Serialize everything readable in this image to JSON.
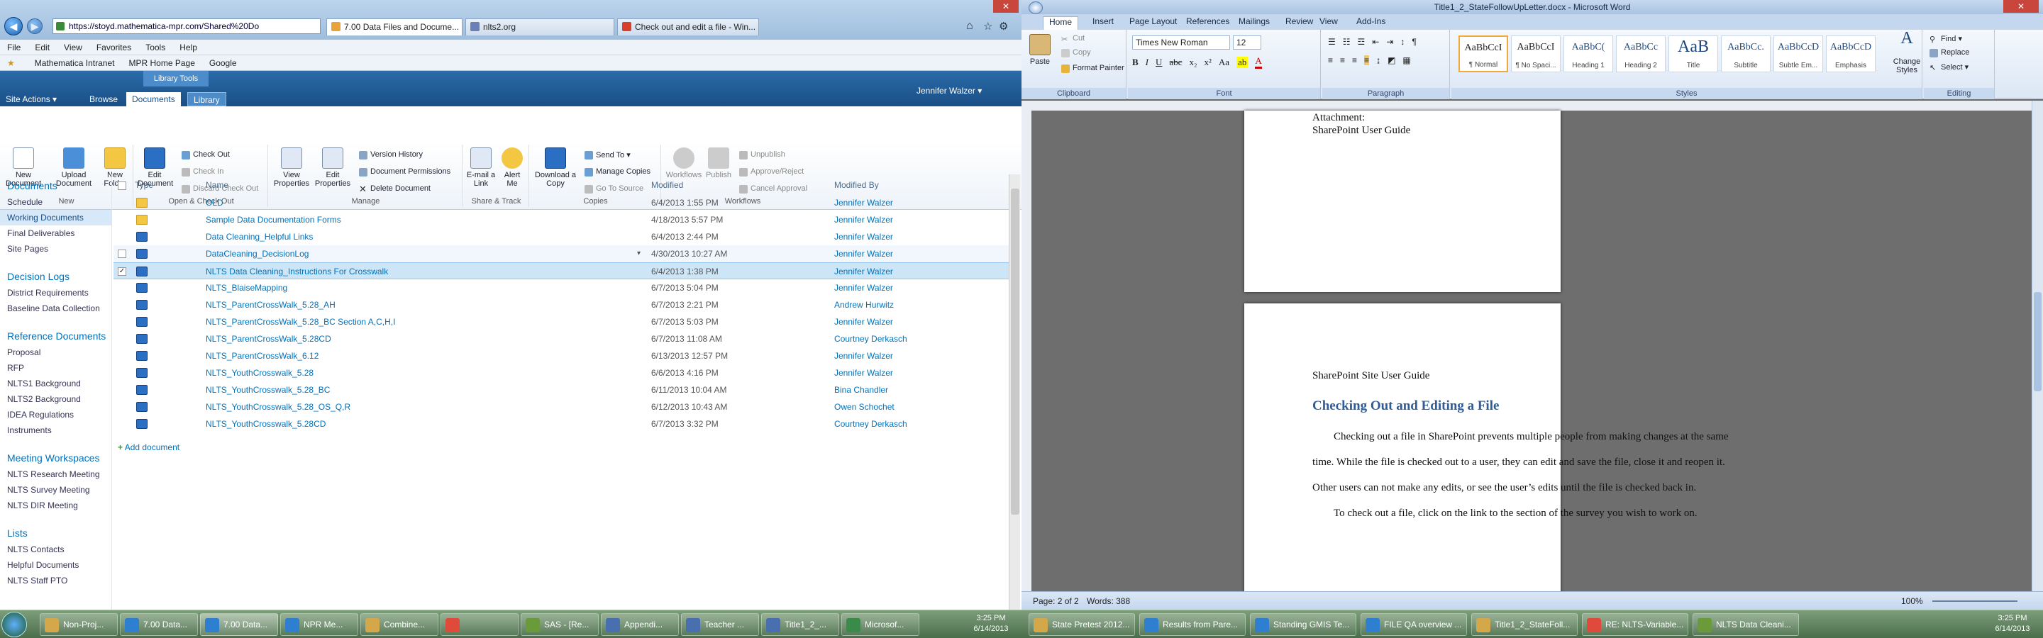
{
  "ie": {
    "url": "https://stoyd.mathematica-mpr.com/Shared%20Do",
    "tabs": [
      "7.00 Data Files and Docume...",
      "nlts2.org",
      "Check out and edit a file - Win..."
    ],
    "menu": [
      "File",
      "Edit",
      "View",
      "Favorites",
      "Tools",
      "Help"
    ],
    "favorites": [
      "Mathematica Intranet",
      "MPR Home Page",
      "Google"
    ]
  },
  "sp": {
    "site_actions": "Site Actions",
    "tabs": [
      "Browse",
      "Documents",
      "Library"
    ],
    "library_tools": "Library Tools",
    "user": "Jennifer Walzer",
    "ribbon_groups": [
      {
        "label": "New",
        "big": [
          "New Document",
          "Upload Document",
          "New Folder"
        ]
      },
      {
        "label": "Open & Check Out",
        "big": [
          "Edit Document"
        ],
        "small": [
          "Check Out",
          "Check In",
          "Discard Check Out"
        ]
      },
      {
        "label": "Manage",
        "big": [
          "View Properties",
          "Edit Properties"
        ],
        "small": [
          "Version History",
          "Document Permissions",
          "Delete Document"
        ]
      },
      {
        "label": "Share & Track",
        "big": [
          "E-mail a Link",
          "Alert Me"
        ]
      },
      {
        "label": "Copies",
        "big": [
          "Download a Copy"
        ],
        "small": [
          "Send To",
          "Manage Copies",
          "Go To Source"
        ]
      },
      {
        "label": "Workflows",
        "big": [
          "Workflows",
          "Publish"
        ],
        "small": [
          "Unpublish",
          "Approve/Reject",
          "Cancel Approval"
        ]
      }
    ],
    "nav": {
      "documents": {
        "head": "Documents",
        "items": [
          "Schedule",
          "Working Documents",
          "Final Deliverables",
          "Site Pages"
        ]
      },
      "decision": {
        "head": "Decision Logs",
        "items": [
          "District Requirements",
          "Baseline Data Collection"
        ]
      },
      "reference": {
        "head": "Reference Documents",
        "items": [
          "Proposal",
          "RFP",
          "NLTS1 Background",
          "NLTS2 Background",
          "IDEA Regulations",
          "Instruments"
        ]
      },
      "meeting": {
        "head": "Meeting Workspaces",
        "items": [
          "NLTS Research Meeting",
          "NLTS Survey Meeting",
          "NLTS DIR Meeting"
        ]
      },
      "lists": {
        "head": "Lists",
        "items": [
          "NLTS Contacts",
          "Helpful Documents",
          "NLTS Staff PTO"
        ]
      }
    },
    "columns": {
      "type": "Type",
      "name": "Name",
      "modified": "Modified",
      "by": "Modified By"
    },
    "rows": [
      {
        "kind": "folder",
        "name": "OLD",
        "modified": "6/4/2013 1:55 PM",
        "by": "Jennifer Walzer"
      },
      {
        "kind": "folder",
        "name": "Sample Data Documentation Forms",
        "modified": "4/18/2013 5:57 PM",
        "by": "Jennifer Walzer"
      },
      {
        "kind": "doc",
        "name": "Data Cleaning_Helpful Links",
        "modified": "6/4/2013 2:44 PM",
        "by": "Jennifer Walzer"
      },
      {
        "kind": "doc",
        "name": "DataCleaning_DecisionLog",
        "modified": "4/30/2013 10:27 AM",
        "by": "Jennifer Walzer"
      },
      {
        "kind": "doc",
        "name": "NLTS Data Cleaning_Instructions For Crosswalk",
        "modified": "6/4/2013 1:38 PM",
        "by": "Jennifer Walzer"
      },
      {
        "kind": "doc",
        "name": "NLTS_BlaiseMapping",
        "modified": "6/7/2013 5:04 PM",
        "by": "Jennifer Walzer"
      },
      {
        "kind": "doc",
        "name": "NLTS_ParentCrossWalk_5.28_AH",
        "modified": "6/7/2013 2:21 PM",
        "by": "Andrew Hurwitz"
      },
      {
        "kind": "doc",
        "name": "NLTS_ParentCrossWalk_5.28_BC Section A,C,H,I",
        "modified": "6/7/2013 5:03 PM",
        "by": "Jennifer Walzer"
      },
      {
        "kind": "doc",
        "name": "NLTS_ParentCrossWalk_5.28CD",
        "modified": "6/7/2013 11:08 AM",
        "by": "Courtney Derkasch"
      },
      {
        "kind": "doc",
        "name": "NLTS_ParentCrossWalk_6.12",
        "modified": "6/13/2013 12:57 PM",
        "by": "Jennifer Walzer"
      },
      {
        "kind": "doc",
        "name": "NLTS_YouthCrosswalk_5.28",
        "modified": "6/6/2013 4:16 PM",
        "by": "Jennifer Walzer"
      },
      {
        "kind": "doc",
        "name": "NLTS_YouthCrosswalk_5.28_BC",
        "modified": "6/11/2013 10:04 AM",
        "by": "Bina Chandler"
      },
      {
        "kind": "doc",
        "name": "NLTS_YouthCrosswalk_5.28_OS_Q,R",
        "modified": "6/12/2013 10:43 AM",
        "by": "Owen Schochet"
      },
      {
        "kind": "doc",
        "name": "NLTS_YouthCrosswalk_5.28CD",
        "modified": "6/7/2013 3:32 PM",
        "by": "Courtney Derkasch"
      }
    ],
    "add_document": "Add document"
  },
  "word": {
    "title": "Title1_2_StateFollowUpLetter.docx - Microsoft Word",
    "tabs": [
      "Home",
      "Insert",
      "Page Layout",
      "References",
      "Mailings",
      "Review",
      "View",
      "Add-Ins"
    ],
    "clipboard": {
      "paste": "Paste",
      "cut": "Cut",
      "copy": "Copy",
      "painter": "Format Painter",
      "label": "Clipboard"
    },
    "font": {
      "name": "Times New Roman",
      "size": "12",
      "label": "Font"
    },
    "paragraph_label": "Paragraph",
    "styles_label": "Styles",
    "styles": [
      {
        "sample": "AaBbCcI",
        "name": "¶ Normal"
      },
      {
        "sample": "AaBbCcI",
        "name": "¶ No Spaci..."
      },
      {
        "sample": "AaBbC(",
        "name": "Heading 1"
      },
      {
        "sample": "AaBbCc",
        "name": "Heading 2"
      },
      {
        "sample": "AaB",
        "name": "Title"
      },
      {
        "sample": "AaBbCc.",
        "name": "Subtitle"
      },
      {
        "sample": "AaBbCcD",
        "name": "Subtle Em..."
      },
      {
        "sample": "AaBbCcD",
        "name": "Emphasis"
      }
    ],
    "change_styles": "Change Styles",
    "editing": {
      "find": "Find",
      "replace": "Replace",
      "select": "Select",
      "label": "Editing"
    },
    "page1": {
      "line1": "Attachment:",
      "line2": "SharePoint User Guide"
    },
    "page2": {
      "header": "SharePoint Site User Guide",
      "heading": "Checking Out and Editing a File",
      "p1": "Checking out a file in SharePoint prevents multiple people from making changes at the same",
      "p2": "time. While the file is checked out to a user, they can edit and save the file, close it and reopen it.",
      "p3": "Other users can not make any edits, or see the user’s edits until the file is checked back in.",
      "p4": "To check out a file, click on the link to the section of the survey you wish to work on."
    },
    "status": {
      "page": "Page: 2 of 2",
      "words": "Words: 388",
      "zoom": "100%"
    }
  },
  "taskbar_left": {
    "items": [
      "Non-Proj...",
      "7.00 Data...",
      "7.00 Data...",
      "NPR Me...",
      "Combine...",
      "",
      "SAS - [Re...",
      "Appendi...",
      "Teacher ...",
      "Title1_2_...",
      "Microsof..."
    ],
    "time": "3:25 PM",
    "date": "6/14/2013"
  },
  "taskbar_right": {
    "items": [
      "State Pretest 2012...",
      "Results from Pare...",
      "Standing GMIS Te...",
      "FILE QA overview ...",
      "Title1_2_StateFoll...",
      "RE: NLTS-Variable...",
      "NLTS Data Cleani..."
    ],
    "time": "3:25 PM",
    "date": "6/14/2013"
  }
}
